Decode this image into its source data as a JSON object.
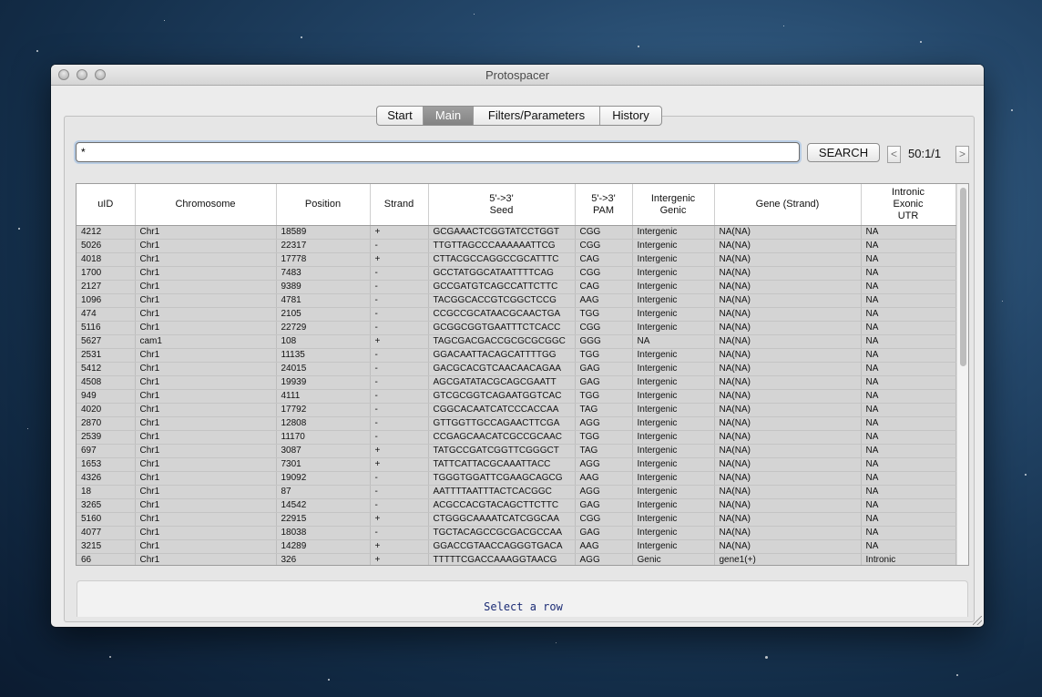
{
  "window": {
    "title": "Protospacer"
  },
  "tabs": [
    "Start",
    "Main",
    "Filters/Parameters",
    "History"
  ],
  "active_tab": "Main",
  "search": {
    "value": "*",
    "button_label": "SEARCH"
  },
  "pagination": {
    "prev": "<",
    "next": ">",
    "label": "50:1/1"
  },
  "table": {
    "columns": [
      "uID",
      "Chromosome",
      "Position",
      "Strand",
      "5'->3'\nSeed",
      "5'->3'\nPAM",
      "Intergenic\nGenic",
      "Gene (Strand)",
      "Intronic\nExonic\nUTR"
    ],
    "rows": [
      [
        "4212",
        "Chr1",
        "18589",
        "+",
        "GCGAAACTCGGTATCCTGGT",
        "CGG",
        "Intergenic",
        "NA(NA)",
        "NA"
      ],
      [
        "5026",
        "Chr1",
        "22317",
        "-",
        "TTGTTAGCCCAAAAAATTCG",
        "CGG",
        "Intergenic",
        "NA(NA)",
        "NA"
      ],
      [
        "4018",
        "Chr1",
        "17778",
        "+",
        "CTTACGCCAGGCCGCATTTC",
        "CAG",
        "Intergenic",
        "NA(NA)",
        "NA"
      ],
      [
        "1700",
        "Chr1",
        "7483",
        "-",
        "GCCTATGGCATAATTTTCAG",
        "CGG",
        "Intergenic",
        "NA(NA)",
        "NA"
      ],
      [
        "2127",
        "Chr1",
        "9389",
        "-",
        "GCCGATGTCAGCCATTCTTC",
        "CAG",
        "Intergenic",
        "NA(NA)",
        "NA"
      ],
      [
        "1096",
        "Chr1",
        "4781",
        "-",
        "TACGGCACCGTCGGCTCCG",
        "AAG",
        "Intergenic",
        "NA(NA)",
        "NA"
      ],
      [
        "474",
        "Chr1",
        "2105",
        "-",
        "CCGCCGCATAACGCAACTGA",
        "TGG",
        "Intergenic",
        "NA(NA)",
        "NA"
      ],
      [
        "5116",
        "Chr1",
        "22729",
        "-",
        "GCGGCGGTGAATTTCTCACC",
        "CGG",
        "Intergenic",
        "NA(NA)",
        "NA"
      ],
      [
        "5627",
        "cam1",
        "108",
        "+",
        "TAGCGACGACCGCGCGCGGC",
        "GGG",
        "NA",
        "NA(NA)",
        "NA"
      ],
      [
        "2531",
        "Chr1",
        "11135",
        "-",
        "GGACAATTACAGCATTTTGG",
        "TGG",
        "Intergenic",
        "NA(NA)",
        "NA"
      ],
      [
        "5412",
        "Chr1",
        "24015",
        "-",
        "GACGCACGTCAACAACAGAA",
        "GAG",
        "Intergenic",
        "NA(NA)",
        "NA"
      ],
      [
        "4508",
        "Chr1",
        "19939",
        "-",
        "AGCGATATACGCAGCGAATT",
        "GAG",
        "Intergenic",
        "NA(NA)",
        "NA"
      ],
      [
        "949",
        "Chr1",
        "4111",
        "-",
        "GTCGCGGTCAGAATGGTCAC",
        "TGG",
        "Intergenic",
        "NA(NA)",
        "NA"
      ],
      [
        "4020",
        "Chr1",
        "17792",
        "-",
        "CGGCACAATCATCCCACCAA",
        "TAG",
        "Intergenic",
        "NA(NA)",
        "NA"
      ],
      [
        "2870",
        "Chr1",
        "12808",
        "-",
        "GTTGGTTGCCAGAACTTCGA",
        "AGG",
        "Intergenic",
        "NA(NA)",
        "NA"
      ],
      [
        "2539",
        "Chr1",
        "11170",
        "-",
        "CCGAGCAACATCGCCGCAAC",
        "TGG",
        "Intergenic",
        "NA(NA)",
        "NA"
      ],
      [
        "697",
        "Chr1",
        "3087",
        "+",
        "TATGCCGATCGGTTCGGGCT",
        "TAG",
        "Intergenic",
        "NA(NA)",
        "NA"
      ],
      [
        "1653",
        "Chr1",
        "7301",
        "+",
        "TATTCATTACGCAAATTACC",
        "AGG",
        "Intergenic",
        "NA(NA)",
        "NA"
      ],
      [
        "4326",
        "Chr1",
        "19092",
        "-",
        "TGGGTGGATTCGAAGCAGCG",
        "AAG",
        "Intergenic",
        "NA(NA)",
        "NA"
      ],
      [
        "18",
        "Chr1",
        "87",
        "-",
        "AATTTTAATTTACTCACGGC",
        "AGG",
        "Intergenic",
        "NA(NA)",
        "NA"
      ],
      [
        "3265",
        "Chr1",
        "14542",
        "-",
        "ACGCCACGTACAGCTTCTTC",
        "GAG",
        "Intergenic",
        "NA(NA)",
        "NA"
      ],
      [
        "5160",
        "Chr1",
        "22915",
        "+",
        "CTGGGCAAAATCATCGGCAA",
        "CGG",
        "Intergenic",
        "NA(NA)",
        "NA"
      ],
      [
        "4077",
        "Chr1",
        "18038",
        "-",
        "TGCTACAGCCGCGACGCCAA",
        "GAG",
        "Intergenic",
        "NA(NA)",
        "NA"
      ],
      [
        "3215",
        "Chr1",
        "14289",
        "+",
        "GGACCGTAACCAGGGTGACA",
        "AAG",
        "Intergenic",
        "NA(NA)",
        "NA"
      ],
      [
        "66",
        "Chr1",
        "326",
        "+",
        "TTTTTCGACCAAAGGTAACG",
        "AGG",
        "Genic",
        "gene1(+)",
        "Intronic"
      ]
    ]
  },
  "status": {
    "text": "Select a row"
  }
}
